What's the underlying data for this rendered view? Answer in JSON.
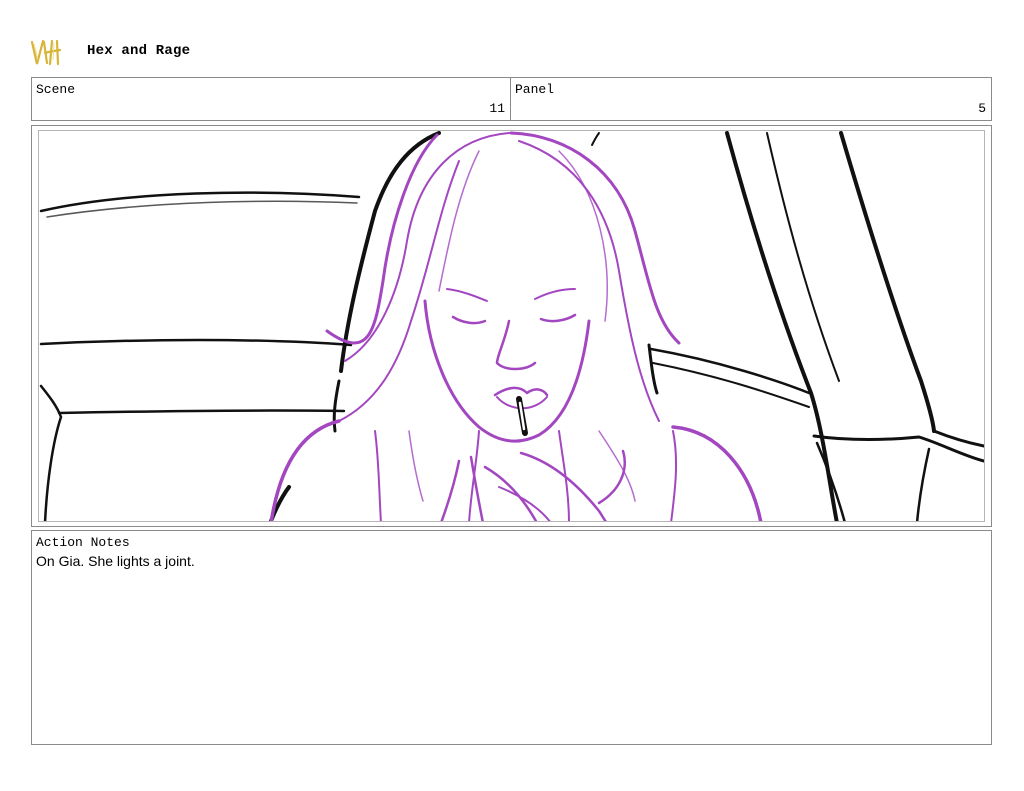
{
  "header": {
    "logo_icon": "vh-logo-icon",
    "title": "Hex and Rage"
  },
  "scene": {
    "label": "Scene",
    "value": "11"
  },
  "panel": {
    "label": "Panel",
    "value": "5"
  },
  "artwork": {
    "icon": "storyboard-sketch",
    "line_color": "#000000",
    "character_color": "#a347c0"
  },
  "action_notes": {
    "label": "Action Notes",
    "text": "On Gia. She lights a joint."
  },
  "colors": {
    "border": "#8a8a8a",
    "logo_gold": "#d8b43a"
  }
}
